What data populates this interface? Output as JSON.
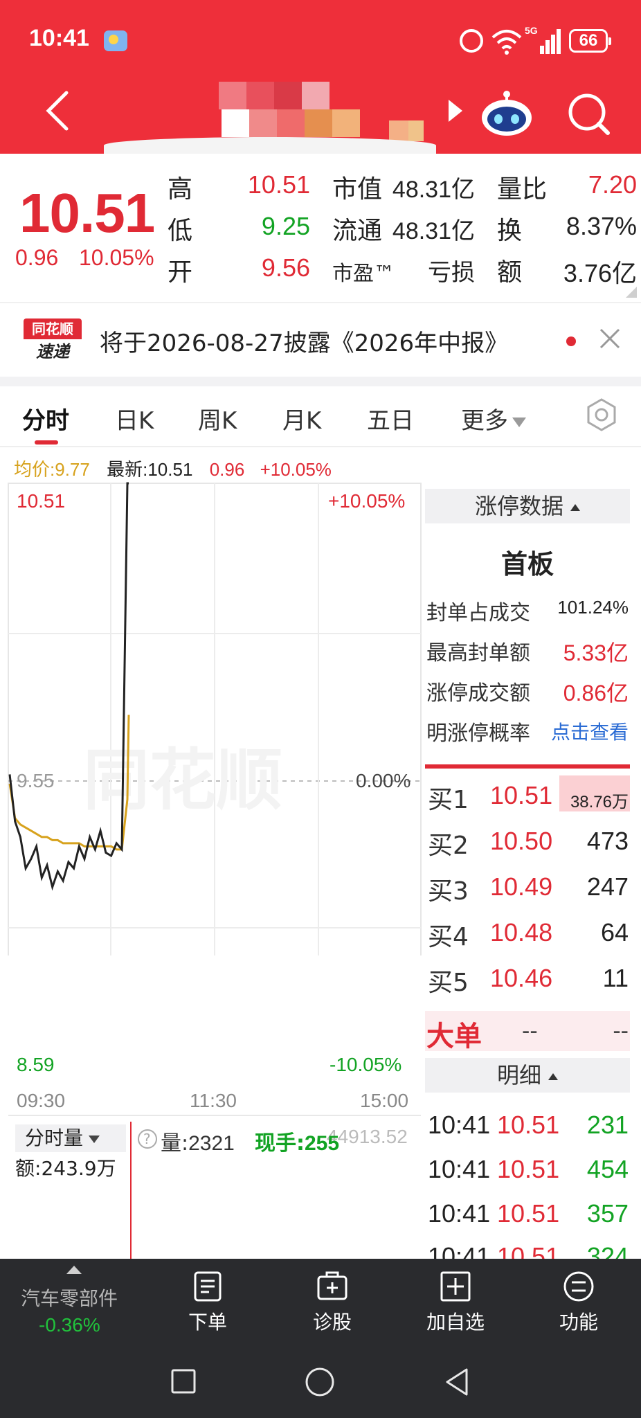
{
  "status_bar": {
    "time": "10:41",
    "network": "5G",
    "battery": "66"
  },
  "quote": {
    "price": "10.51",
    "change": "0.96",
    "change_pct": "10.05%",
    "rows": [
      {
        "l1": "高",
        "v1": "10.51",
        "l2": "市值",
        "v2": "48.31亿",
        "l3": "量比",
        "v3": "7.20"
      },
      {
        "l1": "低",
        "v1": "9.25",
        "l2": "流通",
        "v2": "48.31亿",
        "l3": "换",
        "v3": "8.37%"
      },
      {
        "l1": "开",
        "v1": "9.56",
        "l2": "市盈™",
        "v2": "亏损",
        "l3": "额",
        "v3": "3.76亿"
      }
    ]
  },
  "notice": {
    "logo_top": "同花顺",
    "logo_bottom": "速递",
    "text": "将于2026-08-27披露《2026年中报》"
  },
  "tabs": [
    "分时",
    "日K",
    "周K",
    "月K",
    "五日",
    "更多"
  ],
  "info_row": {
    "avg_label": "均价:",
    "avg": "9.77",
    "latest_label": "最新:",
    "latest": "10.51",
    "change": "0.96",
    "pct": "+10.05%"
  },
  "chart": {
    "y_top": "10.51",
    "y_mid": "9.55",
    "y_bottom": "8.59",
    "pct_top": "+10.05%",
    "pct_mid": "0.00%",
    "pct_bottom": "-10.05%",
    "time_start": "09:30",
    "time_mid": "11:30",
    "time_end": "15:00",
    "watermark": "同花顺",
    "colors": {
      "price": "#222222",
      "avg": "#d7a21d",
      "up": "#e02a35",
      "down": "#12a323"
    }
  },
  "chart_data": {
    "type": "line",
    "series": [
      {
        "values": [
          9.58,
          9.43,
          9.38,
          9.28,
          9.31,
          9.35,
          9.25,
          9.29,
          9.22,
          9.27,
          9.24,
          9.3,
          9.28,
          9.35,
          9.31,
          9.38,
          9.34,
          9.4,
          9.33,
          9.32,
          9.36,
          9.34,
          10.51,
          10.51
        ]
      },
      {
        "values": [
          9.55,
          9.44,
          9.42,
          9.41,
          9.4,
          9.39,
          9.38,
          9.38,
          9.37,
          9.37,
          9.36,
          9.36,
          9.36,
          9.36,
          9.35,
          9.35,
          9.35,
          9.35,
          9.35,
          9.35,
          9.34,
          9.34,
          9.5,
          9.77
        ]
      }
    ],
    "x": [
      "09:30",
      "",
      "",
      "",
      "",
      "",
      "",
      "",
      "",
      "",
      "",
      "",
      "",
      "",
      "",
      "",
      "",
      "",
      "",
      "",
      "",
      "",
      "10:41",
      "10:41"
    ],
    "ylim": [
      8.59,
      10.51
    ]
  },
  "volume": {
    "selector": "分时量",
    "amount_label": "额:",
    "amount": "243.9万",
    "vol_label": "量:",
    "vol": "2321",
    "hand_label": "现手:",
    "hand": "255",
    "extra": "44913.52"
  },
  "limit_panel": {
    "title": "涨停数据",
    "board": "首板",
    "items": [
      {
        "label": "封单占成交",
        "value": "101.24%"
      },
      {
        "label": "最高封单额",
        "value": "5.33亿"
      },
      {
        "label": "涨停成交额",
        "value": "0.86亿"
      },
      {
        "label": "明涨停概率",
        "value": "点击查看"
      }
    ]
  },
  "bids": [
    {
      "label": "买1",
      "price": "10.51",
      "vol": "38.76万"
    },
    {
      "label": "买2",
      "price": "10.50",
      "vol": "473"
    },
    {
      "label": "买3",
      "price": "10.49",
      "vol": "247"
    },
    {
      "label": "买4",
      "price": "10.48",
      "vol": "64"
    },
    {
      "label": "买5",
      "price": "10.46",
      "vol": "11"
    }
  ],
  "big_order": {
    "label": "大单",
    "v1": "--",
    "v2": "--"
  },
  "detail": {
    "title": "明细",
    "trades": [
      {
        "time": "10:41",
        "price": "10.51",
        "vol": "231"
      },
      {
        "time": "10:41",
        "price": "10.51",
        "vol": "454"
      },
      {
        "time": "10:41",
        "price": "10.51",
        "vol": "357"
      },
      {
        "time": "10:41",
        "price": "10.51",
        "vol": "324"
      }
    ]
  },
  "toolbar": {
    "sector_name": "汽车零部件",
    "sector_change": "-0.36%",
    "items": [
      "下单",
      "诊股",
      "加自选",
      "功能"
    ]
  }
}
